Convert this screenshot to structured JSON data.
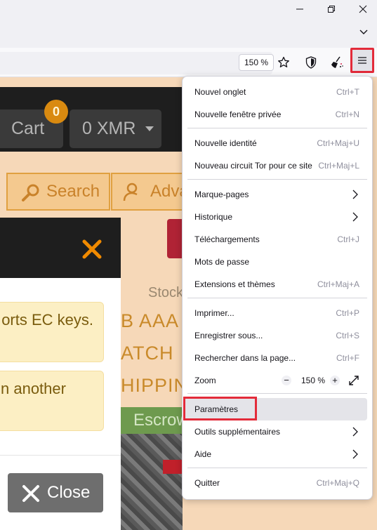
{
  "browser": {
    "zoom_badge": "150 %"
  },
  "page": {
    "cart_badge": "0",
    "cart_label": "Cart",
    "currency_label": "0 XMR",
    "search_tab": "Search",
    "advanced_tab": "Adva",
    "stock_label": "Stock",
    "listing_line_1": "B AAA",
    "listing_line_2": "ATCH",
    "listing_line_3": "HIPPIN",
    "escrow_label": "Escrow"
  },
  "modal": {
    "alert_1": "orts EC keys.",
    "alert_2": "n another",
    "close_label": "Close"
  },
  "menu": {
    "new_tab": {
      "label": "Nouvel onglet",
      "shortcut": "Ctrl+T"
    },
    "new_private": {
      "label": "Nouvelle fenêtre privée",
      "shortcut": "Ctrl+N"
    },
    "new_identity": {
      "label": "Nouvelle identité",
      "shortcut": "Ctrl+Maj+U"
    },
    "new_circuit": {
      "label": "Nouveau circuit Tor pour ce site",
      "shortcut": "Ctrl+Maj+L"
    },
    "bookmarks": {
      "label": "Marque-pages"
    },
    "history": {
      "label": "Historique"
    },
    "downloads": {
      "label": "Téléchargements",
      "shortcut": "Ctrl+J"
    },
    "passwords": {
      "label": "Mots de passe"
    },
    "addons": {
      "label": "Extensions et thèmes",
      "shortcut": "Ctrl+Maj+A"
    },
    "print": {
      "label": "Imprimer...",
      "shortcut": "Ctrl+P"
    },
    "save_as": {
      "label": "Enregistrer sous...",
      "shortcut": "Ctrl+S"
    },
    "find": {
      "label": "Rechercher dans la page...",
      "shortcut": "Ctrl+F"
    },
    "zoom": {
      "label": "Zoom",
      "minus": "−",
      "value": "150 %",
      "plus": "+"
    },
    "settings": {
      "label": "Paramètres"
    },
    "more_tools": {
      "label": "Outils supplémentaires"
    },
    "help": {
      "label": "Aide"
    },
    "quit": {
      "label": "Quitter",
      "shortcut": "Ctrl+Maj+Q"
    }
  },
  "colors": {
    "highlight_box": "#e32b3a",
    "site_accent": "#d98a10",
    "menu_bg": "#ffffff"
  }
}
